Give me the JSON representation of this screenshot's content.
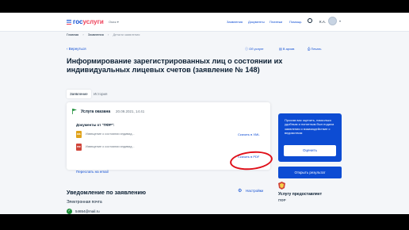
{
  "header": {
    "logo_part1": "гос",
    "logo_part2": "услуги",
    "region": "Омск",
    "nav": [
      "Заявления",
      "Документы",
      "Платежи",
      "Помощь"
    ],
    "user_initials": "К.А."
  },
  "breadcrumb": [
    "Главная",
    "Заявления",
    "Детали заявления"
  ],
  "page": {
    "back": "Вернуться",
    "actions": [
      "Об услуге",
      "В архив",
      "Печать"
    ],
    "title": "Информирование зарегистрированных лиц о состоянии их индивидуальных лицевых счетов (заявление № 148)",
    "tabs": [
      "Заявление",
      "История"
    ]
  },
  "status_card": {
    "status": "Услуга оказана",
    "date": "20.09.2021, 14:41",
    "docs_label": "Документы от \"ПФР\":",
    "documents": [
      {
        "icon": "XML",
        "name": "Извещение о состоянии индивид...",
        "link": "Скачать в XML"
      },
      {
        "icon": "PDF",
        "name": "Извещение о состоянии индивид...",
        "link": "Скачать в PDF"
      }
    ],
    "forward": "Переслать на email"
  },
  "notifications": {
    "title": "Уведомление по заявлению",
    "settings": "Настройки",
    "email_label": "Электронная почта",
    "email_value": "54654@mail.ru"
  },
  "side_panel": {
    "text": "Просим вас оценить, насколько удобным и понятным был подача заявления и взаимодействие с ведомством",
    "rate_button": "Оценить",
    "open_button": "Открыть результат",
    "provider_label": "Услугу предоставляет",
    "provider_value": "ПФР"
  },
  "colors": {
    "accent": "#0d4cd3",
    "brand_red": "#ee3f58",
    "success": "#1f8f3a",
    "annotation": "#e0101a"
  }
}
